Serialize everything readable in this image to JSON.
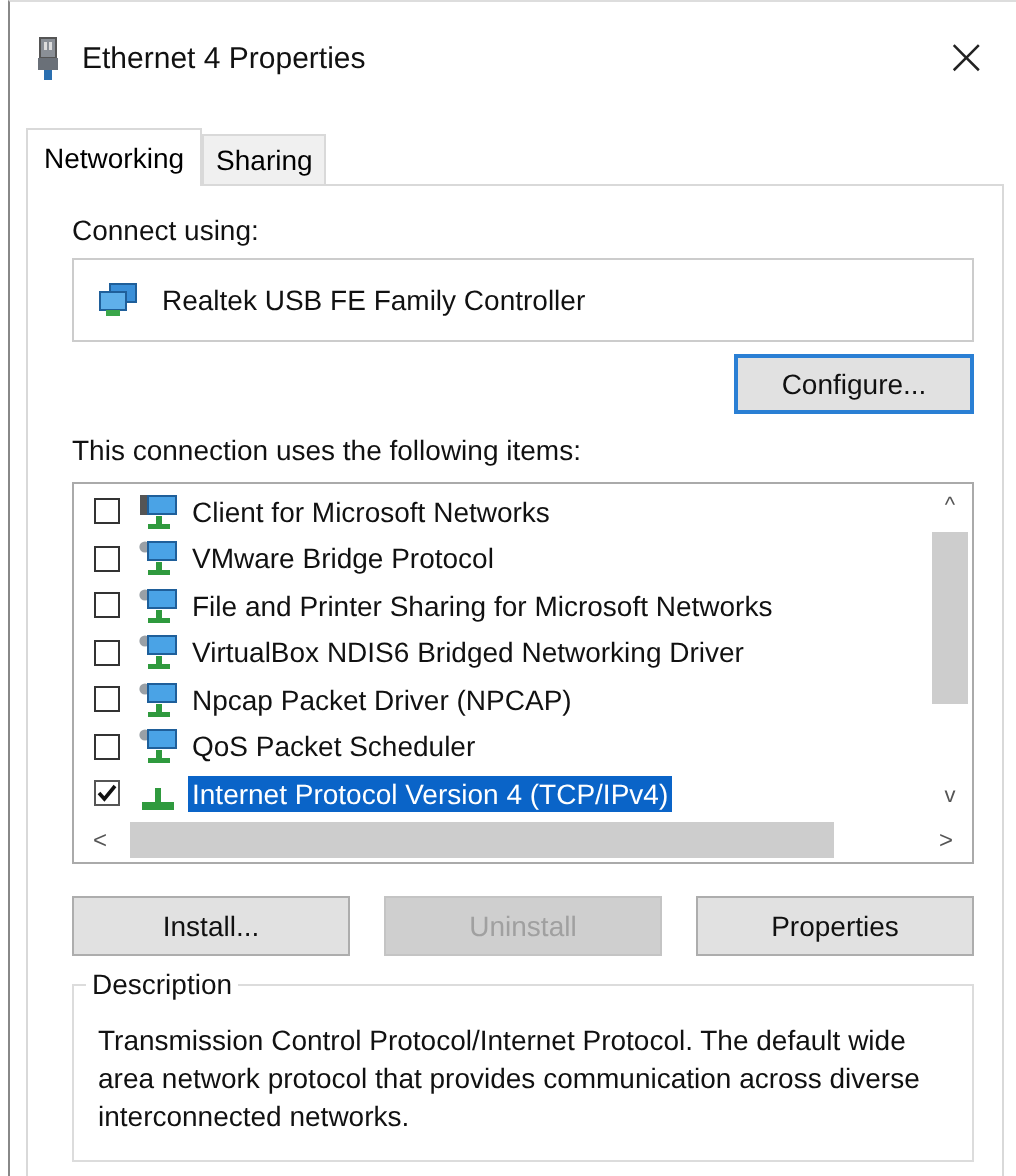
{
  "window": {
    "title": "Ethernet 4 Properties",
    "close": "×"
  },
  "tabs": [
    {
      "label": "Networking",
      "selected": true
    },
    {
      "label": "Sharing",
      "selected": false
    }
  ],
  "connect_using": {
    "label": "Connect using:",
    "adapter": "Realtek USB FE Family Controller"
  },
  "configure_button": {
    "label": "Configure...",
    "default": true
  },
  "items_label": "This connection uses the following items:",
  "items": [
    {
      "label": "Client for Microsoft Networks",
      "checked": false,
      "selected": false,
      "kind": "client"
    },
    {
      "label": "VMware Bridge Protocol",
      "checked": false,
      "selected": false,
      "kind": "service"
    },
    {
      "label": "File and Printer Sharing for Microsoft Networks",
      "checked": false,
      "selected": false,
      "kind": "service"
    },
    {
      "label": "VirtualBox NDIS6 Bridged Networking Driver",
      "checked": false,
      "selected": false,
      "kind": "service"
    },
    {
      "label": "Npcap Packet Driver (NPCAP)",
      "checked": false,
      "selected": false,
      "kind": "service"
    },
    {
      "label": "QoS Packet Scheduler",
      "checked": false,
      "selected": false,
      "kind": "service"
    },
    {
      "label": "Internet Protocol Version 4 (TCP/IPv4)",
      "checked": true,
      "selected": true,
      "kind": "protocol"
    }
  ],
  "scroll_arrows": {
    "up": "^",
    "down": "v",
    "left": "<",
    "right": ">"
  },
  "buttons": [
    {
      "label": "Install...",
      "disabled": false
    },
    {
      "label": "Uninstall",
      "disabled": true
    },
    {
      "label": "Properties",
      "disabled": false
    }
  ],
  "description": {
    "title": "Description",
    "text": "Transmission Control Protocol/Internet Protocol. The default wide area network protocol that provides communication across diverse interconnected networks."
  }
}
